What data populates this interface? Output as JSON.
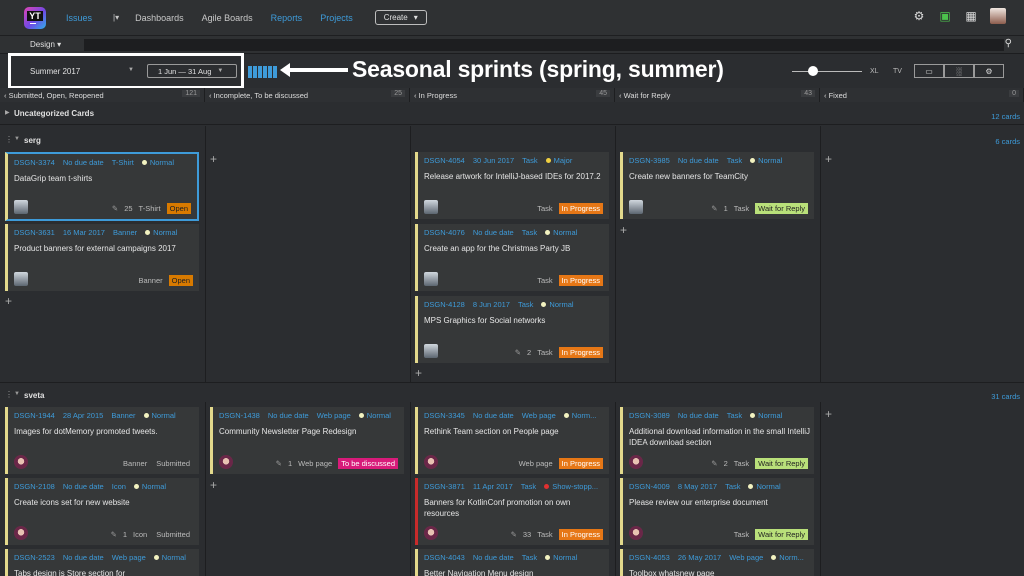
{
  "app": {
    "logo_text": "YT",
    "create_label": "Create"
  },
  "nav": {
    "issues": "Issues",
    "dashboards": "Dashboards",
    "agile_boards": "Agile Boards",
    "reports": "Reports",
    "projects": "Projects"
  },
  "icons": {
    "settings": "gear-icon",
    "gift": "gift-icon",
    "apps": "grid-icon",
    "search": "search-icon"
  },
  "board": {
    "name": "Design",
    "sprint": "Summer 2017",
    "dates": "1 Jun — 31 Aug"
  },
  "annotation": "Seasonal sprints (spring, summer)",
  "size_options": {
    "xl": "XL",
    "tv": "TV"
  },
  "columns": [
    {
      "label": "Submitted, Open, Reopened",
      "count": "121"
    },
    {
      "label": "Incomplete, To be discussed",
      "count": "25"
    },
    {
      "label": "In Progress",
      "count": "45"
    },
    {
      "label": "Wait for Reply",
      "count": "43"
    },
    {
      "label": "Fixed",
      "count": "0"
    }
  ],
  "uncategorized": {
    "label": "Uncategorized Cards",
    "count": "12 cards"
  },
  "swimlanes": [
    {
      "name": "serg",
      "count": "6 cards"
    },
    {
      "name": "sveta",
      "count": "31 cards"
    }
  ],
  "cards": {
    "c1": {
      "id": "DSGN-3374",
      "due": "No due date",
      "type": "T-Shirt",
      "priority": "Normal",
      "title": "DataGrip team t-shirts",
      "comments": "25",
      "type_foot": "T-Shirt",
      "state": "Open"
    },
    "c2": {
      "id": "DSGN-3631",
      "due": "16 Mar 2017",
      "type": "Banner",
      "priority": "Normal",
      "title": "Product banners for external campaigns 2017",
      "type_foot": "Banner",
      "state": "Open"
    },
    "c3": {
      "id": "DSGN-4054",
      "due": "30 Jun 2017",
      "type": "Task",
      "priority": "Major",
      "title": "Release artwork for IntelliJ-based IDEs for 2017.2",
      "type_foot": "Task",
      "state": "In Progress"
    },
    "c4": {
      "id": "DSGN-4076",
      "due": "No due date",
      "type": "Task",
      "priority": "Normal",
      "title": "Create an app for the Christmas Party JB",
      "type_foot": "Task",
      "state": "In Progress"
    },
    "c5": {
      "id": "DSGN-4128",
      "due": "8 Jun 2017",
      "type": "Task",
      "priority": "Normal",
      "title": "MPS Graphics for Social networks",
      "comments": "2",
      "type_foot": "Task",
      "state": "In Progress"
    },
    "c6": {
      "id": "DSGN-3985",
      "due": "No due date",
      "type": "Task",
      "priority": "Normal",
      "title": "Create new banners for TeamCity",
      "comments": "1",
      "type_foot": "Task",
      "state": "Wait for Reply"
    },
    "c7": {
      "id": "DSGN-1944",
      "due": "28 Apr 2015",
      "type": "Banner",
      "priority": "Normal",
      "title": "Images for dotMemory promoted tweets.",
      "type_foot": "Banner",
      "state": "Submitted"
    },
    "c8": {
      "id": "DSGN-2108",
      "due": "No due date",
      "type": "Icon",
      "priority": "Normal",
      "title": "Create icons set for new website",
      "comments": "1",
      "type_foot": "Icon",
      "state": "Submitted"
    },
    "c9": {
      "id": "DSGN-2523",
      "due": "No due date",
      "type": "Web page",
      "priority": "Normal",
      "title": "Tabs design is Store section for"
    },
    "c10": {
      "id": "DSGN-1438",
      "due": "No due date",
      "type": "Web page",
      "priority": "Normal",
      "title": "Community Newsletter Page Redesign",
      "comments": "1",
      "type_foot": "Web page",
      "state": "To be discussed"
    },
    "c11": {
      "id": "DSGN-3345",
      "due": "No due date",
      "type": "Web page",
      "priority": "Norm...",
      "title": "Rethink Team section on People page",
      "type_foot": "Web page",
      "state": "In Progress"
    },
    "c12": {
      "id": "DSGN-3871",
      "due": "11 Apr 2017",
      "type": "Task",
      "priority": "Show-stopp...",
      "title": "Banners for KotlinConf promotion on own resources",
      "comments": "33",
      "type_foot": "Task",
      "state": "In Progress"
    },
    "c13": {
      "id": "DSGN-4043",
      "due": "No due date",
      "type": "Task",
      "priority": "Normal",
      "title": "Better Navigation Menu design"
    },
    "c14": {
      "id": "DSGN-3089",
      "due": "No due date",
      "type": "Task",
      "priority": "Normal",
      "title": "Additional download information in the small IntelliJ IDEA download section",
      "comments": "2",
      "type_foot": "Task",
      "state": "Wait for Reply"
    },
    "c15": {
      "id": "DSGN-4009",
      "due": "8 May 2017",
      "type": "Task",
      "priority": "Normal",
      "title": "Please review our enterprise document",
      "type_foot": "Task",
      "state": "Wait for Reply"
    },
    "c16": {
      "id": "DSGN-4053",
      "due": "26 May 2017",
      "type": "Web page",
      "priority": "Norm...",
      "title": "Toolbox whatsnew page"
    }
  }
}
